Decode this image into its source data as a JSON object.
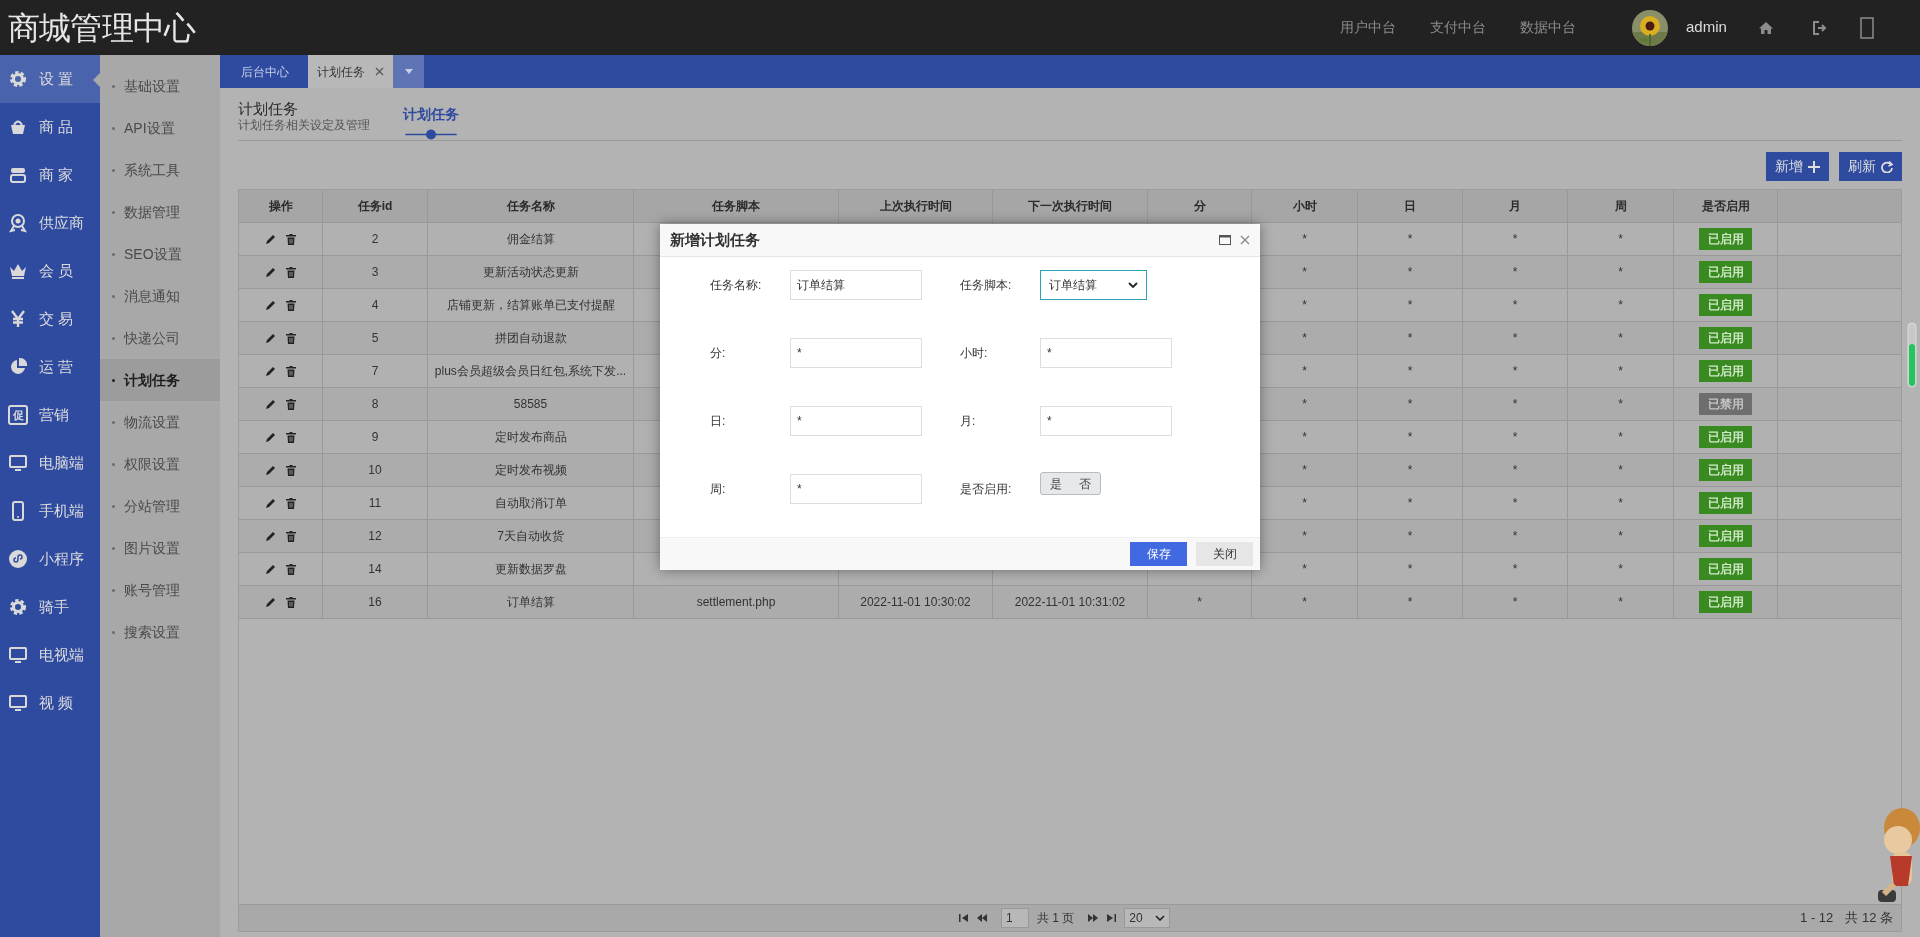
{
  "header": {
    "title": "商城管理中心",
    "nav": [
      "用户中台",
      "支付中台",
      "数据中台"
    ],
    "user": "admin"
  },
  "main_menu": [
    {
      "label": "设 置",
      "selected": true
    },
    {
      "label": "商 品",
      "selected": false
    },
    {
      "label": "商 家",
      "selected": false
    },
    {
      "label": "供应商",
      "selected": false
    },
    {
      "label": "会 员",
      "selected": false
    },
    {
      "label": "交 易",
      "selected": false
    },
    {
      "label": "运 营",
      "selected": false
    },
    {
      "label": "营销",
      "badge_text": "促",
      "selected": false
    },
    {
      "label": "电脑端",
      "selected": false
    },
    {
      "label": "手机端",
      "selected": false
    },
    {
      "label": "小程序",
      "selected": false
    },
    {
      "label": "骑手",
      "selected": false
    },
    {
      "label": "电视端",
      "selected": false
    },
    {
      "label": "视 频",
      "selected": false
    }
  ],
  "sub_menu": [
    {
      "label": "基础设置",
      "selected": false
    },
    {
      "label": "API设置",
      "selected": false
    },
    {
      "label": "系统工具",
      "selected": false
    },
    {
      "label": "数据管理",
      "selected": false
    },
    {
      "label": "SEO设置",
      "selected": false
    },
    {
      "label": "消息通知",
      "selected": false
    },
    {
      "label": "快递公司",
      "selected": false
    },
    {
      "label": "计划任务",
      "selected": true
    },
    {
      "label": "物流设置",
      "selected": false
    },
    {
      "label": "权限设置",
      "selected": false
    },
    {
      "label": "分站管理",
      "selected": false
    },
    {
      "label": "图片设置",
      "selected": false
    },
    {
      "label": "账号管理",
      "selected": false
    },
    {
      "label": "搜索设置",
      "selected": false
    }
  ],
  "tabs": [
    {
      "label": "后台中心",
      "selected": false,
      "closable": false
    },
    {
      "label": "计划任务",
      "selected": true,
      "closable": true
    }
  ],
  "page": {
    "title": "计划任务",
    "subtitle": "计划任务相关设定及管理",
    "tabs": [
      {
        "label": "计划任务",
        "selected": true
      }
    ]
  },
  "toolbar": [
    {
      "label": "新增"
    },
    {
      "label": "刷新"
    }
  ],
  "table": {
    "columns": [
      "操作",
      "任务id",
      "任务名称",
      "任务脚本",
      "上次执行时间",
      "下一次执行时间",
      "分",
      "小时",
      "日",
      "月",
      "周",
      "是否启用"
    ],
    "rows": [
      {
        "id": "2",
        "name": "佣金结算",
        "hour": "*",
        "day": "*",
        "month": "*",
        "week": "*",
        "enabled": true,
        "status": "已启用"
      },
      {
        "id": "3",
        "name": "更新活动状态更新",
        "hour": "*",
        "day": "*",
        "month": "*",
        "week": "*",
        "enabled": true,
        "status": "已启用"
      },
      {
        "id": "4",
        "name": "店铺更新，结算账单已支付提醒",
        "hour": "*",
        "day": "*",
        "month": "*",
        "week": "*",
        "enabled": true,
        "status": "已启用"
      },
      {
        "id": "5",
        "name": "拼团自动退款",
        "hour": "*",
        "day": "*",
        "month": "*",
        "week": "*",
        "enabled": true,
        "status": "已启用"
      },
      {
        "id": "7",
        "name": "plus会员超级会员日红包,系统下发...",
        "hour": "*",
        "day": "*",
        "month": "*",
        "week": "*",
        "enabled": true,
        "status": "已启用"
      },
      {
        "id": "8",
        "name": "58585",
        "hour": "*",
        "day": "*",
        "month": "*",
        "week": "*",
        "enabled": false,
        "status": "已禁用"
      },
      {
        "id": "9",
        "name": "定时发布商品",
        "hour": "*",
        "day": "*",
        "month": "*",
        "week": "*",
        "enabled": true,
        "status": "已启用"
      },
      {
        "id": "10",
        "name": "定时发布视频",
        "hour": "*",
        "day": "*",
        "month": "*",
        "week": "*",
        "enabled": true,
        "status": "已启用"
      },
      {
        "id": "11",
        "name": "自动取消订单",
        "hour": "*",
        "day": "*",
        "month": "*",
        "week": "*",
        "enabled": true,
        "status": "已启用"
      },
      {
        "id": "12",
        "name": "7天自动收货",
        "hour": "*",
        "day": "*",
        "month": "*",
        "week": "*",
        "enabled": true,
        "status": "已启用"
      },
      {
        "id": "14",
        "name": "更新数据罗盘",
        "hour": "*",
        "day": "*",
        "month": "*",
        "week": "*",
        "enabled": true,
        "status": "已启用"
      },
      {
        "id": "16",
        "name": "订单结算",
        "script": "settlement.php",
        "last_run": "2022-11-01 10:30:02",
        "next_run": "2022-11-01 10:31:02",
        "minute": "*",
        "hour": "*",
        "day": "*",
        "month": "*",
        "week": "*",
        "enabled": true,
        "status": "已启用"
      }
    ]
  },
  "pagination": {
    "page": "1",
    "pages_text": "共 1 页",
    "page_size": "20",
    "range": "1 - 12",
    "total": "共 12 条"
  },
  "dialog": {
    "title": "新增计划任务",
    "fields": [
      {
        "label": "任务名称:",
        "kind": "text",
        "value": "订单结算"
      },
      {
        "label": "任务脚本:",
        "kind": "select",
        "value": "订单结算"
      },
      {
        "label": "分:",
        "kind": "text",
        "value": "*"
      },
      {
        "label": "小时:",
        "kind": "text",
        "value": "*"
      },
      {
        "label": "日:",
        "kind": "text",
        "value": "*"
      },
      {
        "label": "月:",
        "kind": "text",
        "value": "*"
      },
      {
        "label": "周:",
        "kind": "text",
        "value": "*"
      },
      {
        "label": "是否启用:",
        "kind": "toggle",
        "on": false,
        "options": [
          "是",
          "否"
        ]
      }
    ],
    "buttons": [
      {
        "label": "保存",
        "primary": true
      },
      {
        "label": "关闭",
        "primary": false
      }
    ]
  }
}
